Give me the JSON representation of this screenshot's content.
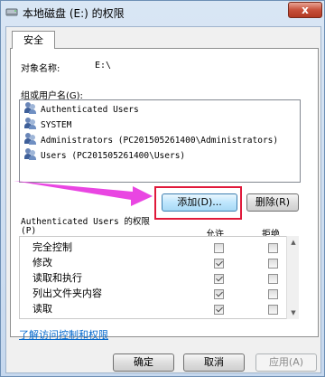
{
  "window": {
    "title": "本地磁盘 (E:) 的权限",
    "close_label": "x"
  },
  "tab": {
    "label": "安全"
  },
  "object_name": {
    "label": "对象名称:",
    "value": "E:\\"
  },
  "group_users": {
    "label": "组或用户名(G):",
    "items": [
      {
        "name": "Authenticated Users"
      },
      {
        "name": "SYSTEM"
      },
      {
        "name": "Administrators (PC201505261400\\Administrators)"
      },
      {
        "name": "Users (PC201505261400\\Users)"
      }
    ]
  },
  "buttons": {
    "add": "添加(D)...",
    "remove": "删除(R)",
    "ok": "确定",
    "cancel": "取消",
    "apply": "应用(A)"
  },
  "permissions": {
    "header_line1": "Authenticated Users 的权限",
    "header_line2": "(P)",
    "allow_label": "允许",
    "deny_label": "拒绝",
    "rows": [
      {
        "name": "完全控制",
        "allow": false,
        "deny": false
      },
      {
        "name": "修改",
        "allow": true,
        "deny": false
      },
      {
        "name": "读取和执行",
        "allow": true,
        "deny": false
      },
      {
        "name": "列出文件夹内容",
        "allow": true,
        "deny": false
      },
      {
        "name": "读取",
        "allow": true,
        "deny": false
      }
    ]
  },
  "link": {
    "label": "了解访问控制和权限"
  },
  "colors": {
    "highlight": "#e0193a",
    "arrow": "#e83ce0",
    "link": "#0066cc"
  }
}
